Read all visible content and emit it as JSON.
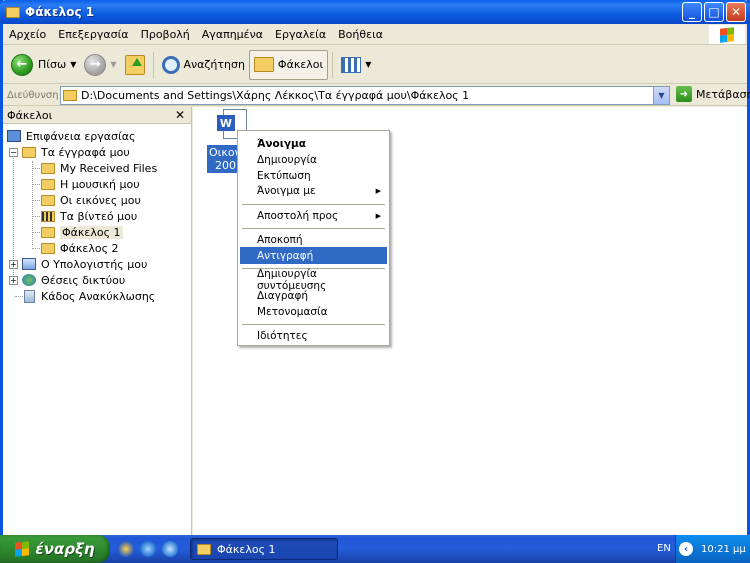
{
  "window": {
    "title": "Φάκελος 1"
  },
  "menubar": {
    "items": [
      "Αρχείο",
      "Επεξεργασία",
      "Προβολή",
      "Αγαπημένα",
      "Εργαλεία",
      "Βοήθεια"
    ]
  },
  "toolbar": {
    "back_label": "Πίσω",
    "search_label": "Αναζήτηση",
    "folders_label": "Φάκελοι"
  },
  "address": {
    "label": "Διεύθυνση",
    "value": "D:\\Documents and Settings\\Χάρης Λέκκος\\Τα έγγραφά μου\\Φάκελος 1",
    "go_label": "Μετάβαση"
  },
  "folders_pane": {
    "header": "Φάκελοι",
    "close": "✕",
    "tree": [
      "Επιφάνεια εργασίας",
      "Τα έγγραφά μου",
      "My Received Files",
      "Η μουσική μου",
      "Οι εικόνες μου",
      "Τα βίντεό μου",
      "Φάκελος 1",
      "Φάκελος 2",
      "Ο Υπολογιστής μου",
      "Θέσεις δικτύου",
      "Κάδος Ανακύκλωσης"
    ]
  },
  "content": {
    "file_label_line1": "Οικονο",
    "file_label_line2": "2001.d"
  },
  "context_menu": {
    "items": [
      "Άνοιγμα",
      "Δημιουργία",
      "Εκτύπωση",
      "Άνοιγμα με",
      "Αποστολή προς",
      "Αποκοπή",
      "Αντιγραφή",
      "Δημιουργία συντόμευσης",
      "Διαγραφή",
      "Μετονομασία",
      "Ιδιότητες"
    ],
    "highlighted": "Αντιγραφή"
  },
  "taskbar": {
    "start_label": "έναρξη",
    "task_label": "Φάκελος 1",
    "language": "EN",
    "clock": "10:21 μμ"
  },
  "colors": {
    "selection": "#316ac5",
    "title_bar": "#0a5fe8",
    "start_green": "#2f8a2f"
  }
}
